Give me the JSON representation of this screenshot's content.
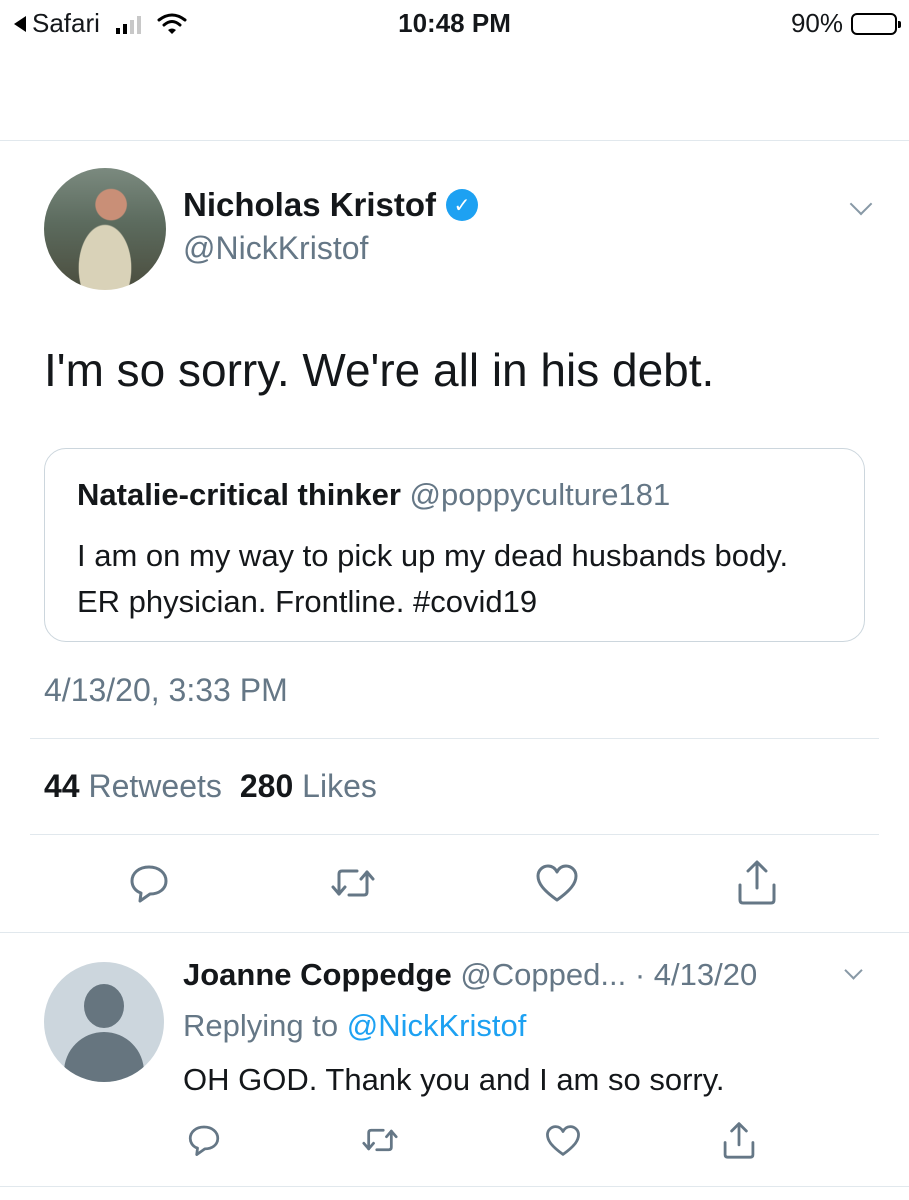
{
  "status_bar": {
    "back_app": "Safari",
    "time": "10:48 PM",
    "battery": "90%",
    "battery_level": 0.9
  },
  "tweet": {
    "author_name": "Nicholas Kristof",
    "author_handle": "@NickKristof",
    "text": "I'm so sorry. We're all in his debt.",
    "quote": {
      "name": "Natalie-critical thinker",
      "handle": "@poppyculture181",
      "text": "I am on my way to pick up my dead husbands body. ER physician. Frontline. #covid19"
    },
    "timestamp": "4/13/20, 3:33 PM",
    "stats": {
      "retweets_count": "44",
      "retweets_label": "Retweets",
      "likes_count": "280",
      "likes_label": "Likes"
    }
  },
  "reply": {
    "name": "Joanne Coppedge",
    "meta": "@Copped... · 4/13/20",
    "replying_prefix": "Replying to",
    "replying_to": "@NickKristof",
    "text": "OH GOD. Thank you and I am so sorry."
  },
  "icons": {
    "reply": "reply-icon",
    "retweet": "retweet-icon",
    "like": "heart-icon",
    "share": "share-icon"
  },
  "colors": {
    "link": "#1da1f2",
    "secondary_text": "#657786",
    "verified": "#1da1f2"
  }
}
